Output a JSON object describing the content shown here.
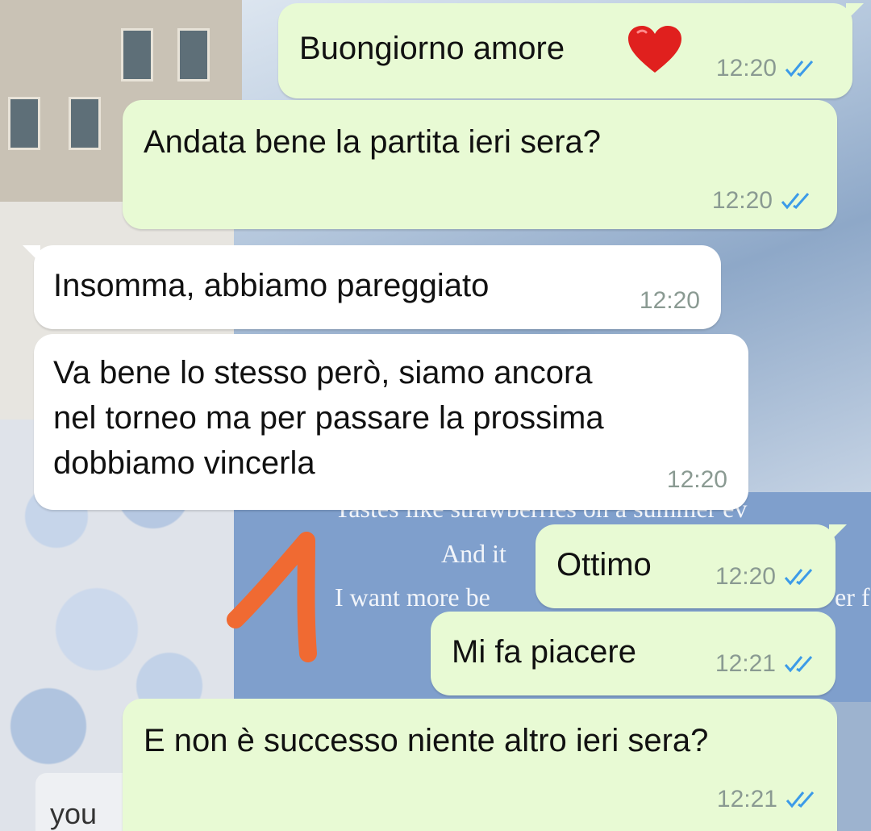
{
  "wallpaper": {
    "quote_line1": "Tastes like strawberries on a summer ev",
    "quote_line2": "And it",
    "quote_line3": "I want more be",
    "quote_line3_tail": "er f",
    "you_label": "you"
  },
  "messages": [
    {
      "direction": "out",
      "text": "Buongiorno amore",
      "emoji": "heart",
      "time": "12:20",
      "status": "read"
    },
    {
      "direction": "out",
      "text": "Andata bene la partita ieri sera?",
      "time": "12:20",
      "status": "read"
    },
    {
      "direction": "in",
      "text": "Insomma, abbiamo pareggiato",
      "time": "12:20"
    },
    {
      "direction": "in",
      "text": "Va bene lo stesso però, siamo ancora\nnel torneo ma per passare la prossima\ndobbiamo vincerla",
      "time": "12:20"
    },
    {
      "direction": "out",
      "text": "Ottimo",
      "time": "12:20",
      "status": "read"
    },
    {
      "direction": "out",
      "text": "Mi fa piacere",
      "time": "12:21",
      "status": "read"
    },
    {
      "direction": "out",
      "text": "E non è successo niente altro ieri sera?",
      "time": "12:21",
      "status": "read"
    }
  ],
  "colors": {
    "outgoing_bubble": "#e8fad4",
    "incoming_bubble": "#ffffff",
    "read_ticks": "#3c9be8",
    "annotation_stroke": "#f06a32"
  }
}
